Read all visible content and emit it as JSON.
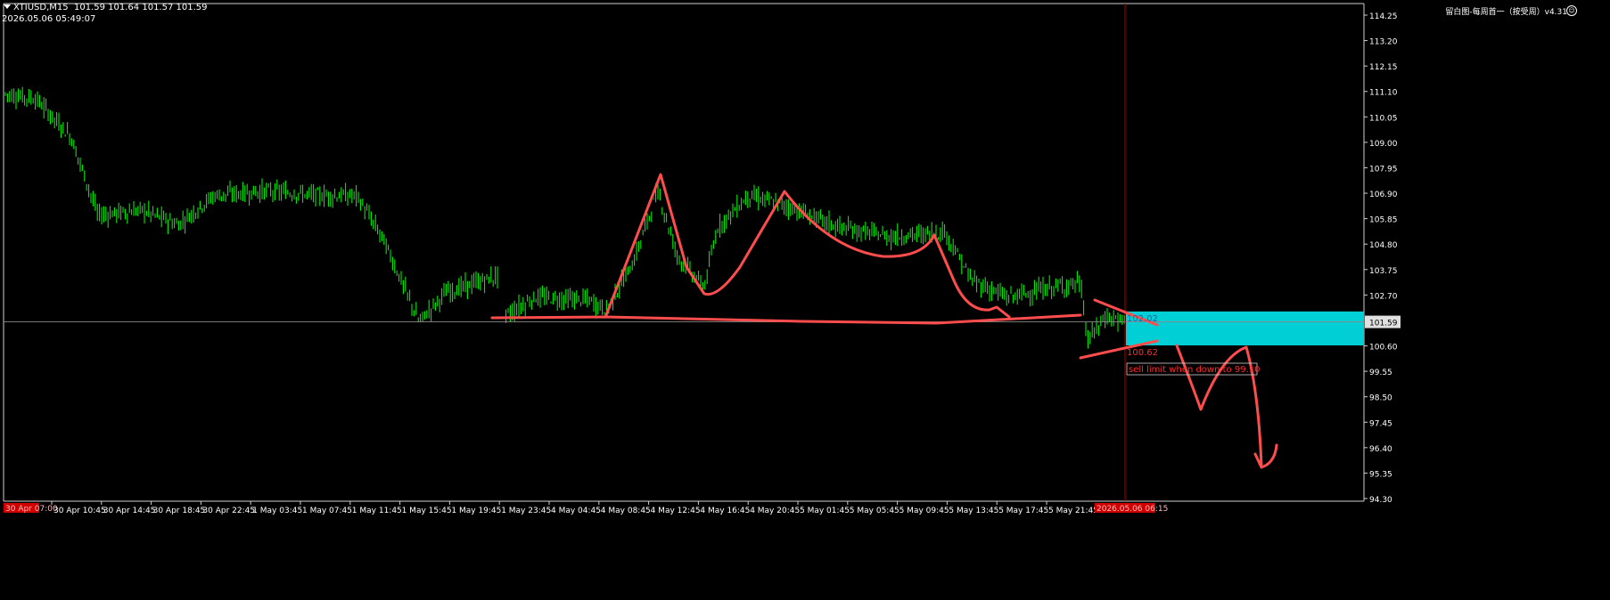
{
  "header": {
    "symbol": "XTIUSD,M15",
    "ohlc": "101.59 101.64 101.57 101.59",
    "timestamp": "2026.05.06 05:49:07"
  },
  "indicator_label": "留白图-每周首一（按受周）v4.31",
  "smile_icon": "smiley-icon",
  "colors": {
    "bg": "#000000",
    "candles": "#00ff00",
    "grid": "#3a3a3a",
    "annotation": "#ff4d4d",
    "zone": "#00cfd6",
    "cursor": "#b00000",
    "price_badge": "#e0e0e0"
  },
  "price_axis": {
    "ticks": [
      "114.25",
      "113.20",
      "112.15",
      "111.10",
      "110.05",
      "109.00",
      "107.95",
      "106.90",
      "105.85",
      "104.80",
      "103.75",
      "102.70",
      "101.59",
      "100.60",
      "99.55",
      "98.50",
      "97.45",
      "96.40",
      "95.35",
      "94.30"
    ],
    "current": "101.59"
  },
  "time_axis": {
    "left_marker": "30 Apr 07:00",
    "labels": [
      "30 Apr 10:45",
      "30 Apr 14:45",
      "30 Apr 18:45",
      "30 Apr 22:45",
      "1 May 03:45",
      "1 May 07:45",
      "1 May 11:45",
      "1 May 15:45",
      "1 May 19:45",
      "1 May 23:45",
      "4 May 04:45",
      "4 May 08:45",
      "4 May 12:45",
      "4 May 16:45",
      "4 May 20:45",
      "5 May 01:45",
      "5 May 05:45",
      "5 May 09:45",
      "5 May 13:45",
      "5 May 17:45",
      "5 May 21:45"
    ],
    "cursor_label": "2026.05.06 06:15"
  },
  "annotations": {
    "zone_top": "102.02",
    "zone_bottom": "100.62",
    "note": "sell limit when down to 99.10"
  }
}
